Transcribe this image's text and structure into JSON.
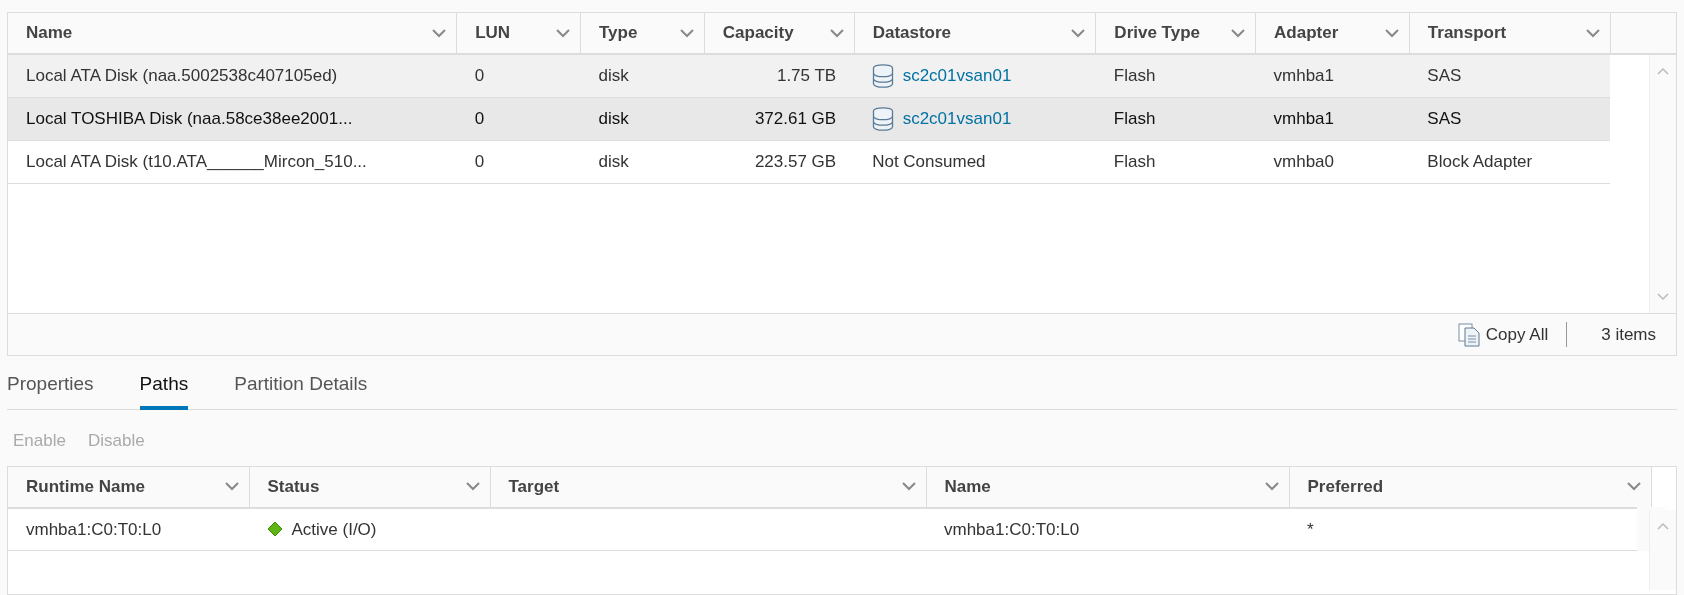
{
  "devices_grid": {
    "columns": [
      "Name",
      "LUN",
      "Type",
      "Capacity",
      "Datastore",
      "Drive Type",
      "Adapter",
      "Transport"
    ],
    "rows": [
      {
        "name": "Local ATA Disk (naa.5002538c407105ed)",
        "lun": "0",
        "type": "disk",
        "capacity": "1.75 TB",
        "datastore": {
          "kind": "link",
          "text": "sc2c01vsan01"
        },
        "drive_type": "Flash",
        "adapter": "vmhba1",
        "transport": "SAS",
        "selected": false,
        "hovered": true
      },
      {
        "name": "Local TOSHIBA Disk (naa.58ce38ee2001...",
        "lun": "0",
        "type": "disk",
        "capacity": "372.61 GB",
        "datastore": {
          "kind": "link",
          "text": "sc2c01vsan01"
        },
        "drive_type": "Flash",
        "adapter": "vmhba1",
        "transport": "SAS",
        "selected": true,
        "hovered": false
      },
      {
        "name": "Local ATA Disk (t10.ATA______Mircon_510...",
        "lun": "0",
        "type": "disk",
        "capacity": "223.57 GB",
        "datastore": {
          "kind": "text",
          "text": "Not Consumed"
        },
        "drive_type": "Flash",
        "adapter": "vmhba0",
        "transport": "Block Adapter",
        "selected": false,
        "hovered": false
      }
    ],
    "footer": {
      "copy_button": "Copy All",
      "count": "3 items"
    }
  },
  "tabs": [
    {
      "label": "Properties",
      "selected": false
    },
    {
      "label": "Paths",
      "selected": true
    },
    {
      "label": "Partition Details",
      "selected": false
    }
  ],
  "toolbar": [
    {
      "label": "Enable",
      "disabled": true
    },
    {
      "label": "Disable",
      "disabled": true
    }
  ],
  "paths_grid": {
    "columns": [
      "Runtime Name",
      "Status",
      "Target",
      "Name",
      "Preferred"
    ],
    "rows": [
      {
        "runtime_name": "vmhba1:C0:T0:L0",
        "status": {
          "kind": "active",
          "text": "Active (I/O)"
        },
        "target": "",
        "name": "vmhba1:C0:T0:L0",
        "preferred": "*"
      }
    ]
  }
}
